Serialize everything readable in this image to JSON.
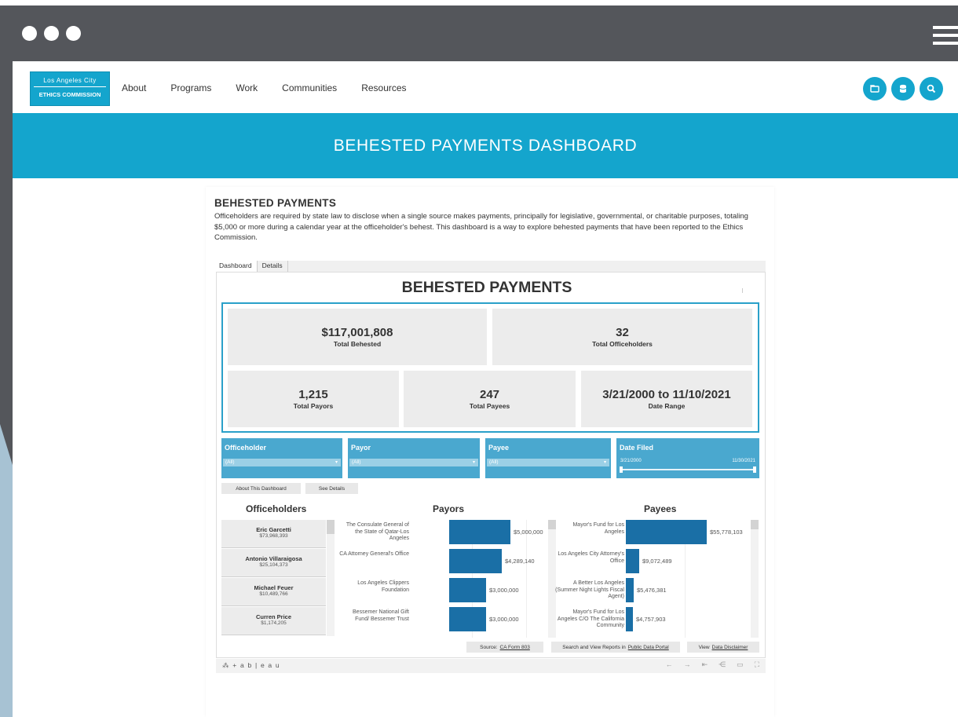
{
  "nav": {
    "logo_line1": "Los Angeles City",
    "logo_line2": "ETHICS COMMISSION",
    "links": [
      "About",
      "Programs",
      "Work",
      "Communities",
      "Resources"
    ]
  },
  "banner": {
    "title": "BEHESTED PAYMENTS DASHBOARD"
  },
  "intro": {
    "heading": "BEHESTED PAYMENTS",
    "text": "Officeholders are required by state law to disclose when a single source makes payments, principally for legislative, governmental, or charitable purposes, totaling $5,000 or more during a calendar year at the officeholder's behest. This dashboard is a way to explore behested payments that have been reported to the Ethics Commission."
  },
  "tabs": [
    "Dashboard",
    "Details"
  ],
  "dashboard": {
    "title": "BEHESTED PAYMENTS",
    "kpis": {
      "total_behested": {
        "value": "$117,001,808",
        "label": "Total Behested"
      },
      "total_officeholders": {
        "value": "32",
        "label": "Total Officeholders"
      },
      "total_payors": {
        "value": "1,215",
        "label": "Total Payors"
      },
      "total_payees": {
        "value": "247",
        "label": "Total Payees"
      },
      "date_range": {
        "value": "3/21/2000 to 11/10/2021",
        "label": "Date Range"
      }
    },
    "filters": {
      "officeholder": {
        "label": "Officeholder",
        "value": "(All)"
      },
      "payor": {
        "label": "Payor",
        "value": "(All)"
      },
      "payee": {
        "label": "Payee",
        "value": "(All)"
      },
      "date_filed": {
        "label": "Date Filed",
        "start": "3/21/2000",
        "end": "11/30/2021"
      }
    },
    "buttons": {
      "about": "About This Dashboard",
      "details": "See Details"
    },
    "sections": {
      "officeholders": "Officeholders",
      "payors": "Payors",
      "payees": "Payees"
    },
    "officeholders": [
      {
        "name": "Eric Garcetti",
        "amount": "$73,968,393"
      },
      {
        "name": "Antonio Villaraigosa",
        "amount": "$25,104,373"
      },
      {
        "name": "Michael Feuer",
        "amount": "$10,489,766"
      },
      {
        "name": "Curren Price",
        "amount": "$1,174,205"
      }
    ],
    "payors": [
      {
        "name": "The Consulate General of the State of Qatar-Los Angeles",
        "value": 5000000,
        "label": "$5,000,000"
      },
      {
        "name": "CA Attorney General's Office",
        "value": 4289140,
        "label": "$4,289,140"
      },
      {
        "name": "Los Angeles Clippers Foundation",
        "value": 3000000,
        "label": "$3,000,000"
      },
      {
        "name": "Bessemer National Gift Fund/ Bessemer Trust",
        "value": 3000000,
        "label": "$3,000,000"
      }
    ],
    "payees": [
      {
        "name": "Mayor's Fund for Los Angeles",
        "value": 55778103,
        "label": "$55,778,103"
      },
      {
        "name": "Los Angeles City Attorney's Office",
        "value": 9072489,
        "label": "$9,072,489"
      },
      {
        "name": "A Better Los Angeles (Summer Night Lights Fiscal Agent)",
        "value": 5476381,
        "label": "$5,476,381"
      },
      {
        "name": "Mayor's Fund for Los Angeles C/O The California Community",
        "value": 4757903,
        "label": "$4,757,903"
      }
    ],
    "footer": {
      "source_prefix": "Source:",
      "source_link": "CA Form 803",
      "portal_prefix": "Search and View Reports in",
      "portal_link": "Public Data Portal",
      "disclaimer_prefix": "View",
      "disclaimer_link": "Data Disclaimer"
    },
    "toolbar": {
      "brand": "+ a b | e a u"
    }
  }
}
